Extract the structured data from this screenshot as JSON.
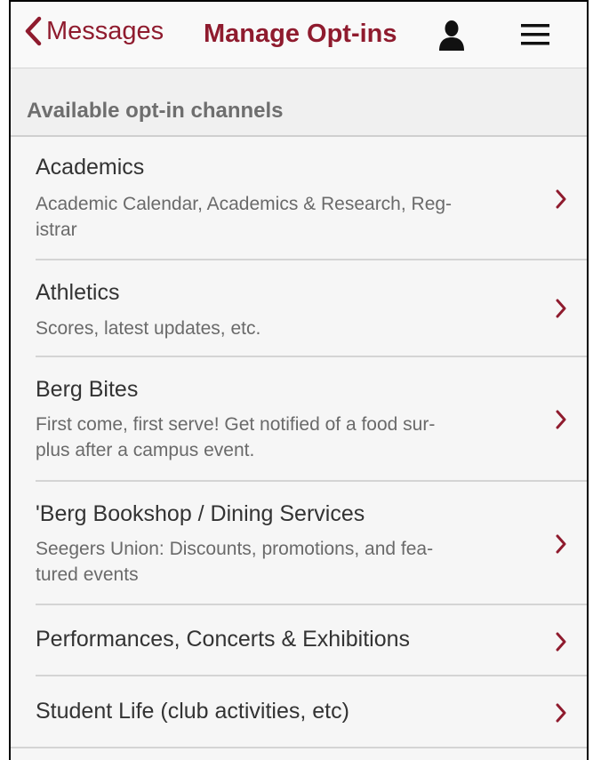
{
  "navbar": {
    "back_label": "Messages",
    "title": "Manage Opt-ins",
    "icons": [
      "user-icon",
      "hamburger-menu-icon"
    ],
    "accent_color": "#8f1b2e"
  },
  "section": {
    "header": "Available opt-in channels"
  },
  "channels": [
    {
      "name": "Academics",
      "desc": "Academic Calendar, Academics & Research, Reg-\nistrar"
    },
    {
      "name": "Athletics",
      "desc": "Scores, latest updates, etc."
    },
    {
      "name": "Berg Bites",
      "desc": "First come, first serve! Get notified of a food sur-\nplus after a campus event."
    },
    {
      "name": "'Berg Bookshop / Dining Services",
      "desc": "Seegers Union: Discounts, promotions, and fea-\ntured events"
    },
    {
      "name": "Performances, Concerts & Exhibitions",
      "desc": ""
    },
    {
      "name": "Student Life (club activities, etc)",
      "desc": ""
    }
  ]
}
